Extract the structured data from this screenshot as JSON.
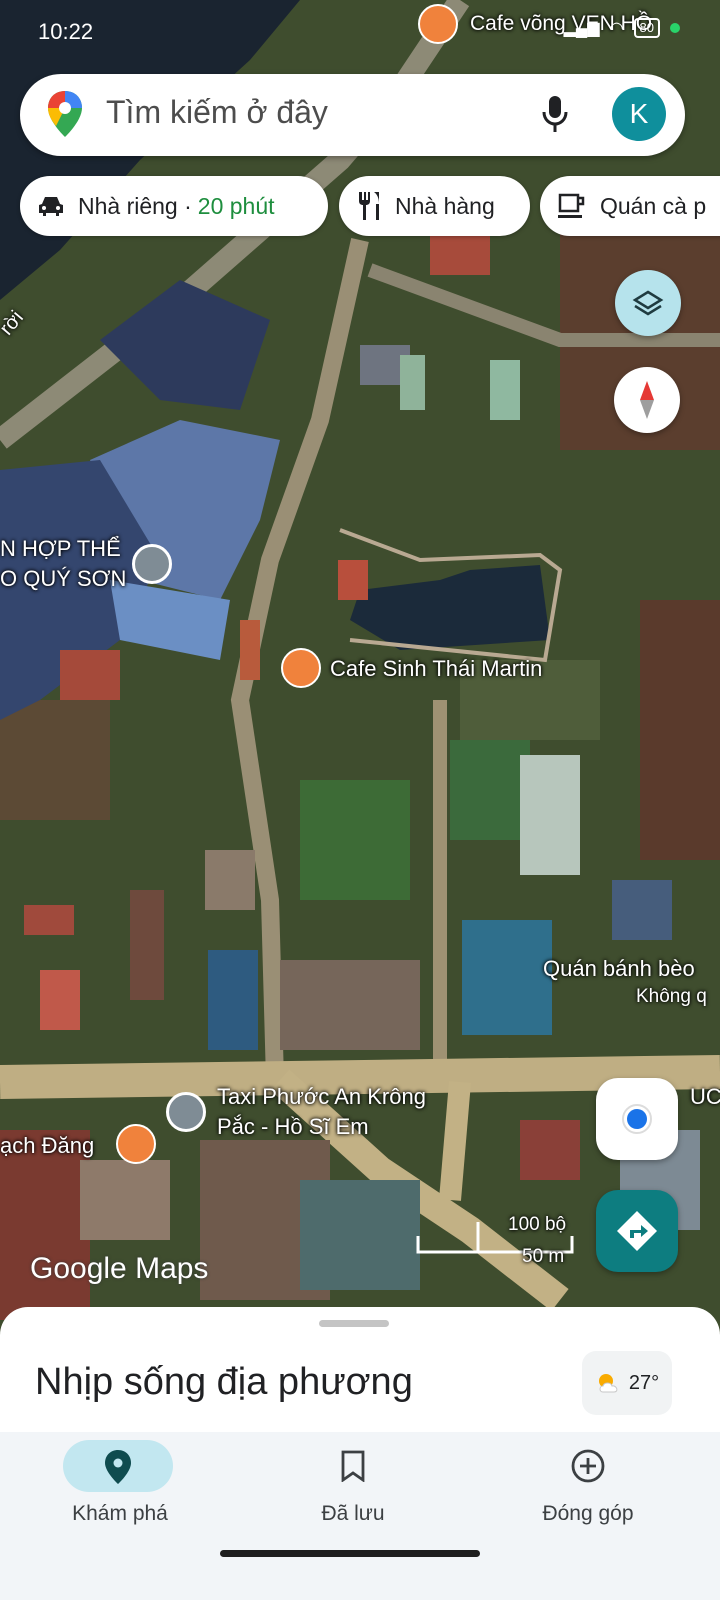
{
  "status_bar": {
    "time": "10:22",
    "battery": "80"
  },
  "search": {
    "placeholder": "Tìm kiếm ở đây",
    "avatar_letter": "K"
  },
  "chips": {
    "home": {
      "label": "Nhà riêng ·",
      "eta": "20 phút"
    },
    "restaurants": {
      "label": "Nhà hàng"
    },
    "cafes": {
      "label": "Quán cà p"
    }
  },
  "map_labels": {
    "top_cafe": "Cafe võng VEN HỒ",
    "left_place_line1": "N HỢP THỂ",
    "left_place_line2": "O QUÝ SƠN",
    "cafe_martin": "Cafe Sinh Thái Martin",
    "banh_beo": "Quán bánh bèo",
    "banh_beo_sub": "Không q",
    "taxi_line1": "Taxi Phước An Krông",
    "taxi_line2": "Pắc - Hồ Sĩ Em",
    "left_cafe": "ạch Đăng",
    "road_label": "rời",
    "right_edge": "UC"
  },
  "scale": {
    "imperial": "100 bộ",
    "metric": "50 m"
  },
  "watermark": "Google Maps",
  "sheet": {
    "title": "Nhịp sống địa phương",
    "temperature": "27°"
  },
  "bottom_nav": [
    {
      "label": "Khám phá",
      "icon": "explore-pin-icon",
      "active": true
    },
    {
      "label": "Đã lưu",
      "icon": "bookmark-icon",
      "active": false
    },
    {
      "label": "Đóng góp",
      "icon": "add-circle-icon",
      "active": false
    }
  ],
  "colors": {
    "accent": "#0f8f9c",
    "active_pill": "#c2e7f0",
    "eta_green": "#1e8e3e",
    "poi_orange": "#f0823c",
    "directions": "#0d7d80"
  }
}
